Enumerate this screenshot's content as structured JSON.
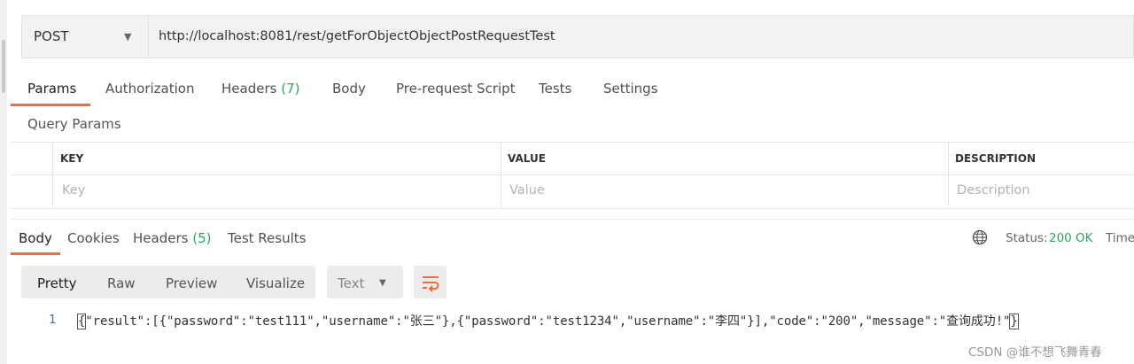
{
  "request": {
    "method": "POST",
    "url": "http://localhost:8081/rest/getForObjectObjectPostRequestTest"
  },
  "request_tabs": [
    {
      "label": "Params",
      "count": ""
    },
    {
      "label": "Authorization",
      "count": ""
    },
    {
      "label": "Headers",
      "count": "(7)"
    },
    {
      "label": "Body",
      "count": ""
    },
    {
      "label": "Pre-request Script",
      "count": ""
    },
    {
      "label": "Tests",
      "count": ""
    },
    {
      "label": "Settings",
      "count": ""
    }
  ],
  "query_params": {
    "title": "Query Params",
    "columns": [
      "KEY",
      "VALUE",
      "DESCRIPTION"
    ],
    "placeholders": [
      "Key",
      "Value",
      "Description"
    ]
  },
  "response_tabs": [
    {
      "label": "Body",
      "count": ""
    },
    {
      "label": "Cookies",
      "count": ""
    },
    {
      "label": "Headers",
      "count": "(5)"
    },
    {
      "label": "Test Results",
      "count": ""
    }
  ],
  "response_status": {
    "status_label": "Status:",
    "status_value": "200 OK",
    "time_label": "Time"
  },
  "view_modes": [
    "Pretty",
    "Raw",
    "Preview",
    "Visualize"
  ],
  "format": "Text",
  "code": {
    "line_number": "1",
    "open_brace": "{",
    "body": "\"result\":[{\"password\":\"test111\",\"username\":\"张三\"},{\"password\":\"test1234\",\"username\":\"李四\"}],\"code\":\"200\",\"message\":\"查询成功!\"",
    "close_brace": "}"
  },
  "watermark": "CSDN @谁不想飞舞青春",
  "colors": {
    "accent": "#f26b3a",
    "success": "#26a65b",
    "line_number": "#3d6cb0"
  }
}
